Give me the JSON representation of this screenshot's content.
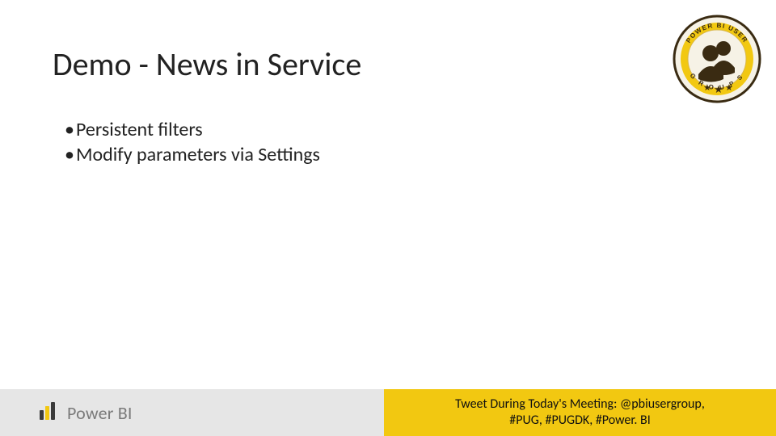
{
  "title": "Demo - News in Service",
  "bullets": [
    "Persistent filters",
    "Modify parameters via Settings"
  ],
  "badge": {
    "name": "Power BI User Groups",
    "accent": "#f2c811",
    "ring": "#3a2b12"
  },
  "footer": {
    "logo_text": "Power BI",
    "tweet_line1": "Tweet During Today's Meeting: @pbiusergroup,",
    "tweet_line2": "#PUG, #PUGDK, #Power. BI",
    "right_bg": "#f2c811",
    "left_bg": "#e6e6e6"
  }
}
